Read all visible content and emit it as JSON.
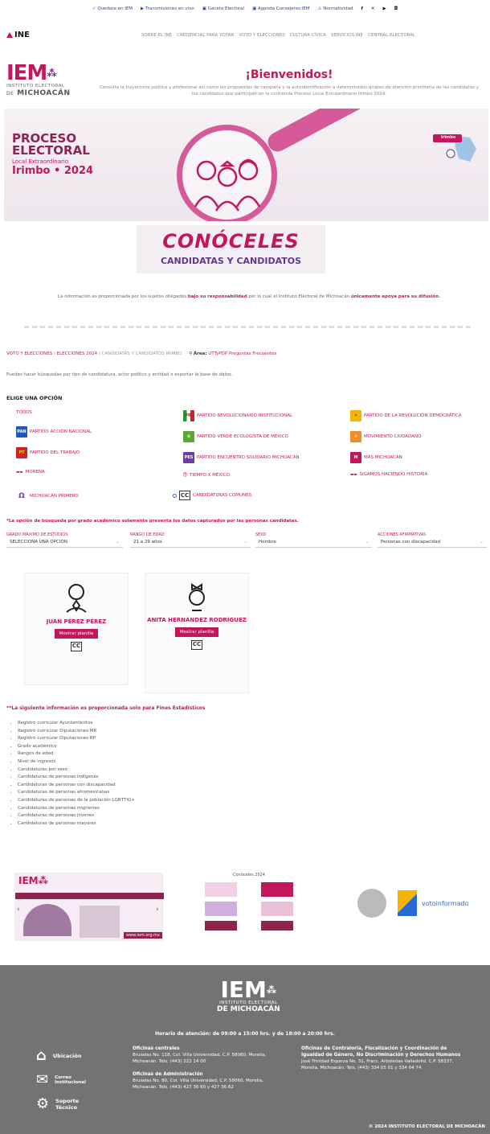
{
  "topbar": [
    "Quedate en IEM",
    "Transmisiones en vivo",
    "Gaceta Electoral",
    "Agenda Consejeros IEM",
    "Normatividad"
  ],
  "nav": {
    "logo": "INE",
    "links": [
      "SOBRE EL INE",
      "CREDENCIAL PARA VOTAR",
      "VOTO Y ELECCIONES",
      "CULTURA CÍVICA",
      "SERVICIOS INE",
      "CENTRAL ELECTORAL"
    ]
  },
  "header": {
    "logo_big": "IEM",
    "logo_small": "INSTITUTO ELECTORAL",
    "logo_de": "DE",
    "logo_mich": "MICHOACÁN",
    "welcome": "¡Bienvenidos!",
    "welcome_text": "Consulta la trayectoria política y profesional así como las propuestas de campaña y la autoidentificación a determinados grupos de atención prioritaria de las candidatas y los candidatos que participan en la contienda Proceso Local Extraordinario Irimbo 2024."
  },
  "banner": {
    "l1": "PROCESO",
    "l2": "ELECTORAL",
    "l3": "Local Extraordinario",
    "l4": "Irimbo • 2024",
    "map_label": "Irimbo"
  },
  "conoceles": {
    "title": "CONÓCELES",
    "subtitle": "CANDIDATAS Y CANDIDATOS"
  },
  "disclaimer": {
    "a": "La información es proporcionada por los sujetos obligados ",
    "b": "bajo su responsabilidad",
    "c": " por lo cual el Instituto Electoral de Michoacán ",
    "d": "únicamente apoya para su difusión."
  },
  "breadcrumb": {
    "a": "VOTO Y ELECCIONES",
    "b": "ELECCIONES 2024",
    "c": "CANDIDATAS Y CANDIDATOS IRIMBO",
    "area": "Área:",
    "links": "UTTyPDP Preguntas Frecuentes"
  },
  "intro": "Puedes hacer búsquedas por tipo de candidatura, actor político y entidad o exportar la base de datos.",
  "elige": "ELIGE UNA OPCIÓN",
  "parties": {
    "todos": "TODOS",
    "pan": "PARTIDO ACCIÓN NACIONAL",
    "pri": "PARTIDO REVOLUCIONARIO INSTITUCIONAL",
    "prd": "PARTIDO DE LA REVOLUCIÓN DEMOCRÁTICA",
    "pt": "PARTIDO DEL TRABAJO",
    "pvem": "PARTIDO VERDE ECOLOGISTA DE MÉXICO",
    "mc": "MOVIMIENTO CIUDADANO",
    "morena": "MORENA",
    "pes": "PARTIDO ENCUENTRO SOLIDARIO MICHOACÁN",
    "mm": "MÁS MICHOACÁN",
    "mp": "MICHOACÁN PRIMERO",
    "tiempo": "TIEMPO X MÉXICO",
    "sigamos": "SIGAMOS HACIENDO HISTORIA",
    "comunes": "CANDIDATURAS COMUNES",
    "cc": "CC"
  },
  "note": "*La opción de búsqueda por grado académico solamente presenta los datos capturados por las personas candidatas.",
  "filters": [
    {
      "label": "GRADO MÁXIMO DE ESTUDIOS",
      "value": "SELECCIONA UNA OPCIÓN"
    },
    {
      "label": "RANGO DE EDAD",
      "value": "21 a 29 años"
    },
    {
      "label": "SEXO",
      "value": "Hombre"
    },
    {
      "label": "ACCIONES AFIRMATIVAS",
      "value": "Personas con discapacidad"
    }
  ],
  "cards": [
    {
      "name": "JUAN PÉREZ PÉREZ",
      "button": "Mostrar planilla",
      "cc": "CC"
    },
    {
      "name": "ANITA HERNÁNDEZ RODRÍGUEZ",
      "button": "Mostrar planilla",
      "cc": "CC"
    }
  ],
  "statnote": "**La siguiente información es proporcionada solo para Fines Estadísticos",
  "stats": [
    "Registro curricular Ayuntamientos",
    "Registro curricular Diputaciones MR",
    "Registro curricular Diputaciones RP",
    "Grado académico",
    "Rangos de edad",
    "Nivel de ingresos",
    "Candidaturas por sexo",
    "Candidaturas de personas indígenas",
    "Candidaturas de personas con discapacidad",
    "Candidaturas de personas afromexicanas",
    "Candidaturas de personas de la población LGBTTIQ+",
    "Candidaturas de personas migrantes",
    "Candidaturas de personas jóvenes",
    "Candidaturas de personas mayores"
  ],
  "partners": {
    "p2_title": "Conóceles 2024",
    "p3_text": "votoinformado",
    "p1_url": "www.iem.org.mx"
  },
  "footer": {
    "logo_big": "IEM",
    "logo_small": "INSTITUTO ELECTORAL",
    "logo_mich": "DE MICHOACÁN",
    "horario": "Horario de atención: de 09:00 a 15:00 hrs. y de 18:00 a 20:00 hrs.",
    "ubicacion": "Ubicación",
    "correo": "Correo Institucional",
    "soporte": "Soporte Técnico",
    "col1_title": "Oficinas centrales",
    "col1_text": "Bruselas No. 118, Col. Villa Universidad, C.P. 58060, Morelia, Michoacán. Tels. (443) 322 14 00",
    "col1b_title": "Oficinas de Administración",
    "col1b_text": "Bruselas No. 80, Col. Villa Universidad, C.P. 58060, Morelia, Michoacán. Tels. (443) 427 36 60 y 427 36 62",
    "col2_title": "Oficinas de Contraloría, Fiscalización y Coordinación de Igualdad de Género, No Discriminación y Derechos Humanos",
    "col2_text": "José Trinidad Esparza No. 31, Fracc. Arboledas Valladolid, C.P. 58337, Morelia, Michoacán. Tels. (443) 334 05 01 y 334 64 74",
    "copyright": "© 2024 INSTITUTO ELECTORAL DE MICHOACÁN"
  }
}
